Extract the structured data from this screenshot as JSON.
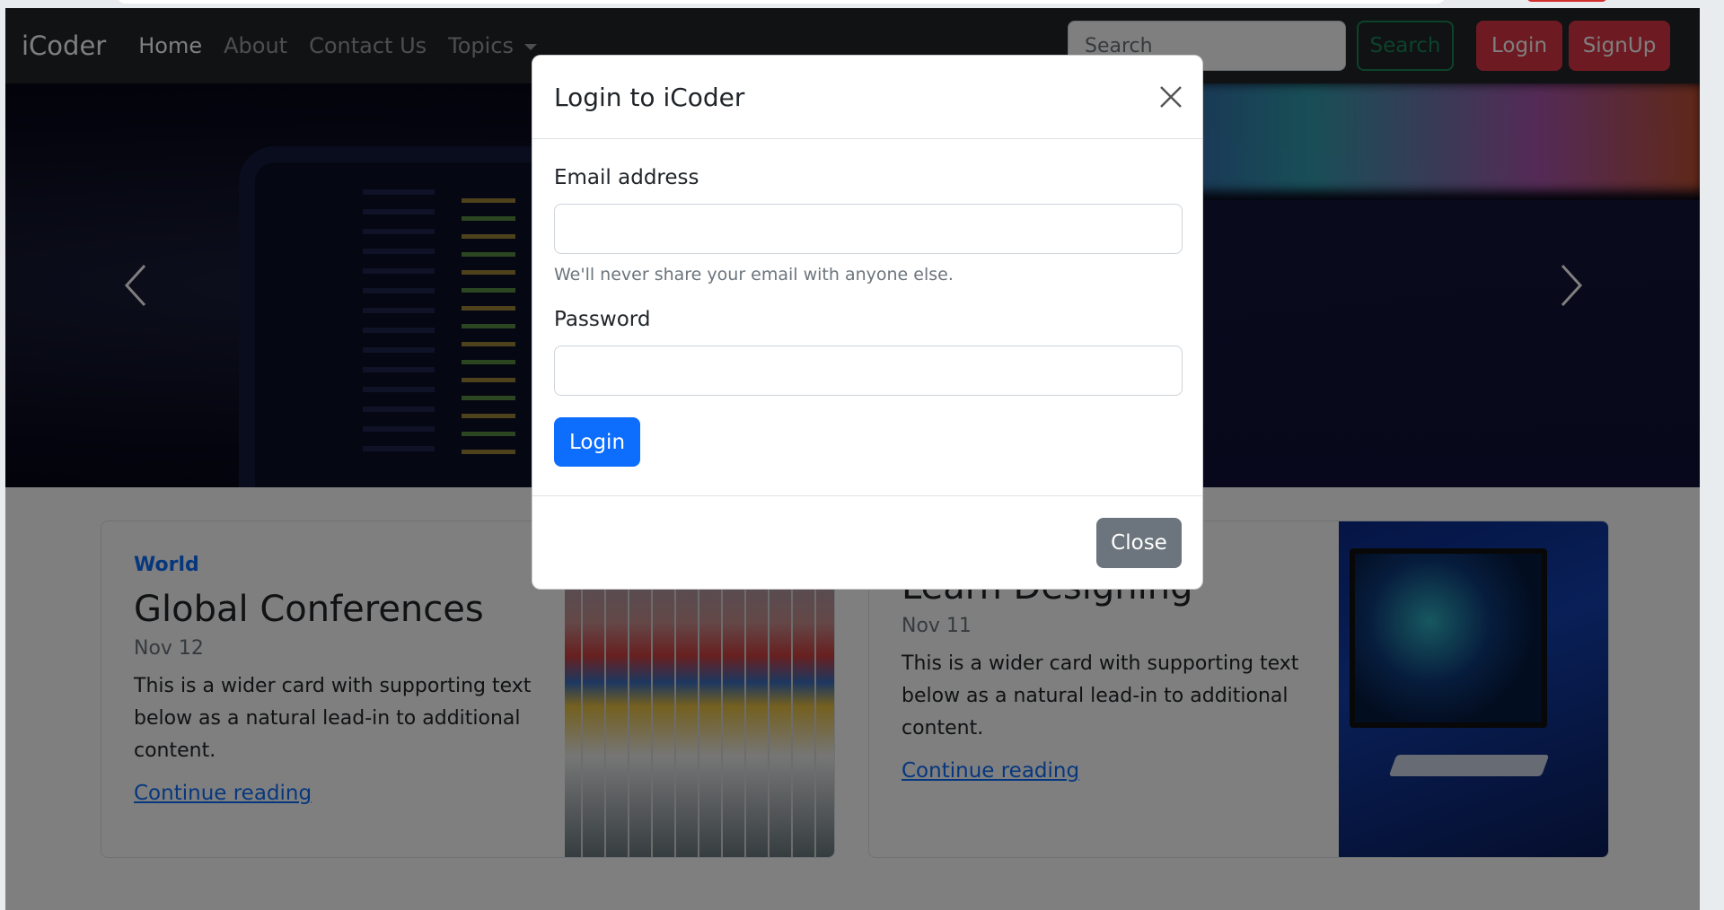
{
  "navbar": {
    "brand": "iCoder",
    "items": [
      {
        "label": "Home",
        "active": true
      },
      {
        "label": "About",
        "active": false
      },
      {
        "label": "Contact Us",
        "active": false
      },
      {
        "label": "Topics",
        "active": false,
        "dropdown": true
      }
    ],
    "search_placeholder": "Search",
    "search_button": "Search",
    "login_button": "Login",
    "signup_button": "SignUp"
  },
  "carousel": {
    "prev_icon": "chevron-left-icon",
    "next_icon": "chevron-right-icon"
  },
  "cards": [
    {
      "category": "World",
      "title": "Global Conferences",
      "date": "Nov 12",
      "text": "This is a wider card with supporting text below as a natural lead-in to additional content.",
      "link": "Continue reading"
    },
    {
      "category": "",
      "title": "Learn Designing",
      "date": "Nov 11",
      "text": "This is a wider card with supporting text below as a natural lead-in to additional content.",
      "link": "Continue reading"
    }
  ],
  "modal": {
    "title": "Login to iCoder",
    "email_label": "Email address",
    "email_value": "",
    "email_help": "We'll never share your email with anyone else.",
    "password_label": "Password",
    "password_value": "",
    "submit": "Login",
    "close": "Close"
  },
  "colors": {
    "navbar_bg": "#212529",
    "primary": "#0d6efd",
    "danger": "#dc3545",
    "success": "#198754",
    "secondary": "#6c757d"
  }
}
